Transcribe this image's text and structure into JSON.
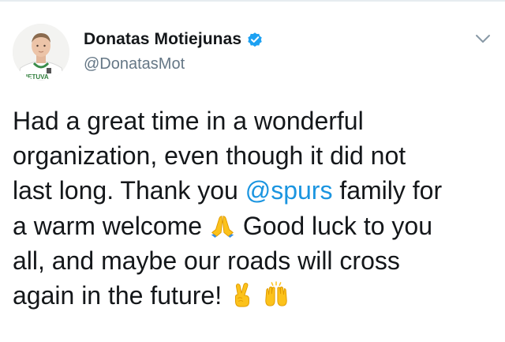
{
  "user": {
    "display_name": "Donatas Motiejunas",
    "handle": "@DonatasMot",
    "verified": true,
    "avatar_jersey_text": "LIETUVA"
  },
  "tweet": {
    "lines": [
      [
        {
          "t": "Had a great time in a wonderful"
        }
      ],
      [
        {
          "t": "organization, even though it did not"
        }
      ],
      [
        {
          "t": "last long. Thank you "
        },
        {
          "t": "@spurs",
          "mention": true
        },
        {
          "t": " family for"
        }
      ],
      [
        {
          "t": "a warm welcome "
        },
        {
          "emoji": "folded-hands-icon"
        },
        {
          "t": " Good luck to you"
        }
      ],
      [
        {
          "t": "all, and maybe our roads will cross"
        }
      ],
      [
        {
          "t": "again in the future! "
        },
        {
          "emoji": "victory-hand-icon"
        },
        {
          "t": " "
        },
        {
          "emoji": "raising-hands-icon"
        }
      ]
    ]
  },
  "colors": {
    "text": "#14171a",
    "secondary": "#657786",
    "link": "#1b95e0",
    "verified": "#1da1f2",
    "emoji": "#fcc21b"
  },
  "icons": {
    "verified": "verified-badge-icon",
    "menu": "chevron-down-icon"
  }
}
